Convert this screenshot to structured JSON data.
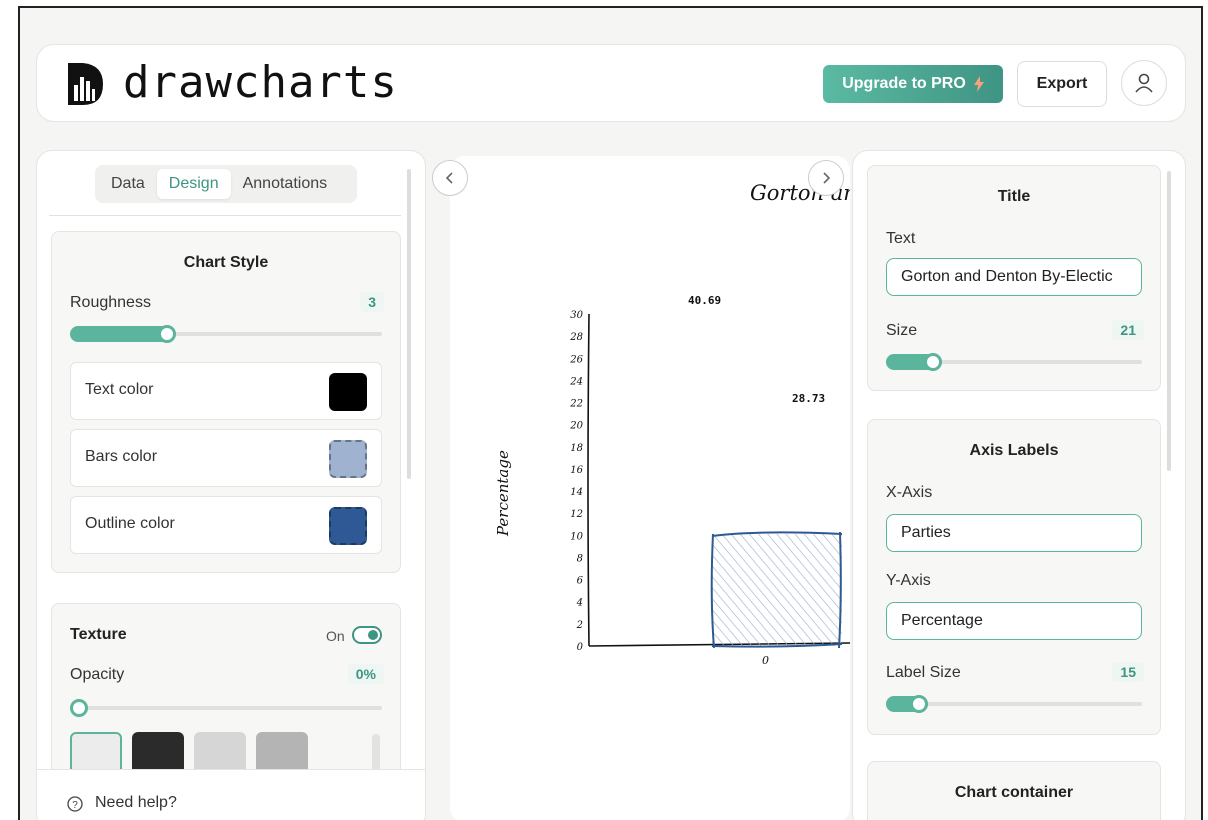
{
  "header": {
    "brand": "drawcharts",
    "upgrade_label": "Upgrade to PRO",
    "export_label": "Export"
  },
  "left": {
    "tabs": [
      "Data",
      "Design",
      "Annotations"
    ],
    "chart_style": {
      "title": "Chart Style",
      "roughness_label": "Roughness",
      "roughness_value": "3",
      "colors": [
        {
          "label": "Text color",
          "hex": "#000000"
        },
        {
          "label": "Bars color",
          "hex": "#9fb2cf"
        },
        {
          "label": "Outline color",
          "hex": "#2f5994"
        }
      ]
    },
    "texture": {
      "label": "Texture",
      "state": "On",
      "opacity_label": "Opacity",
      "opacity_value": "0%"
    },
    "help": "Need help?"
  },
  "chart": {
    "title": "Gorton and Denton By-Election",
    "ylabel": "Percentage",
    "yticks": [
      "0",
      "2",
      "4",
      "6",
      "8",
      "10",
      "12",
      "14",
      "16",
      "18",
      "20",
      "22",
      "24",
      "26",
      "28",
      "30"
    ],
    "data_labels": [
      "40.69",
      "28.73"
    ],
    "x_tick": "0"
  },
  "right": {
    "title_section": {
      "title": "Title",
      "text_label": "Text",
      "text_value": "Gorton and Denton By-Electic",
      "size_label": "Size",
      "size_value": "21"
    },
    "axis_section": {
      "title": "Axis Labels",
      "x_label": "X-Axis",
      "x_value": "Parties",
      "y_label": "Y-Axis",
      "y_value": "Percentage",
      "label_size_label": "Label Size",
      "label_size_value": "15"
    },
    "container_title": "Chart container"
  },
  "colors": {
    "accent": "#3f9483",
    "bars": "#9fb2cf",
    "outline": "#2f5994"
  }
}
